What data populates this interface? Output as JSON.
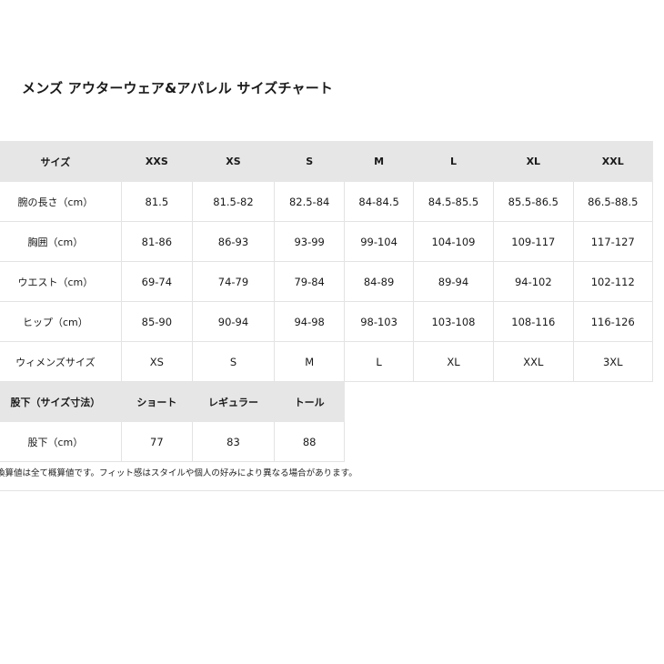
{
  "title": "メンズ アウターウェア&アパレル サイズチャート",
  "size_table": {
    "header": [
      "サイズ",
      "XXS",
      "XS",
      "S",
      "M",
      "L",
      "XL",
      "XXL"
    ],
    "rows": [
      {
        "label": "腕の長さ（cm）",
        "values": [
          "81.5",
          "81.5-82",
          "82.5-84",
          "84-84.5",
          "84.5-85.5",
          "85.5-86.5",
          "86.5-88.5"
        ]
      },
      {
        "label": "胸囲（cm）",
        "values": [
          "81-86",
          "86-93",
          "93-99",
          "99-104",
          "104-109",
          "109-117",
          "117-127"
        ]
      },
      {
        "label": "ウエスト（cm）",
        "values": [
          "69-74",
          "74-79",
          "79-84",
          "84-89",
          "89-94",
          "94-102",
          "102-112"
        ]
      },
      {
        "label": "ヒップ（cm）",
        "values": [
          "85-90",
          "90-94",
          "94-98",
          "98-103",
          "103-108",
          "108-116",
          "116-126"
        ]
      },
      {
        "label": "ウィメンズサイズ",
        "values": [
          "XS",
          "S",
          "M",
          "L",
          "XL",
          "XXL",
          "3XL"
        ]
      }
    ]
  },
  "inseam_table": {
    "header": [
      "股下（サイズ寸法）",
      "ショート",
      "レギュラー",
      "トール"
    ],
    "rows": [
      {
        "label": "股下（cm）",
        "values": [
          "77",
          "83",
          "88"
        ]
      }
    ]
  },
  "note": "換算値は全て概算値です。フィット感はスタイルや個人の好みにより異なる場合があります。",
  "colors": {
    "header_bg": "#e6e6e6",
    "border": "#e3e3e3",
    "text": "#1a1a1a"
  }
}
